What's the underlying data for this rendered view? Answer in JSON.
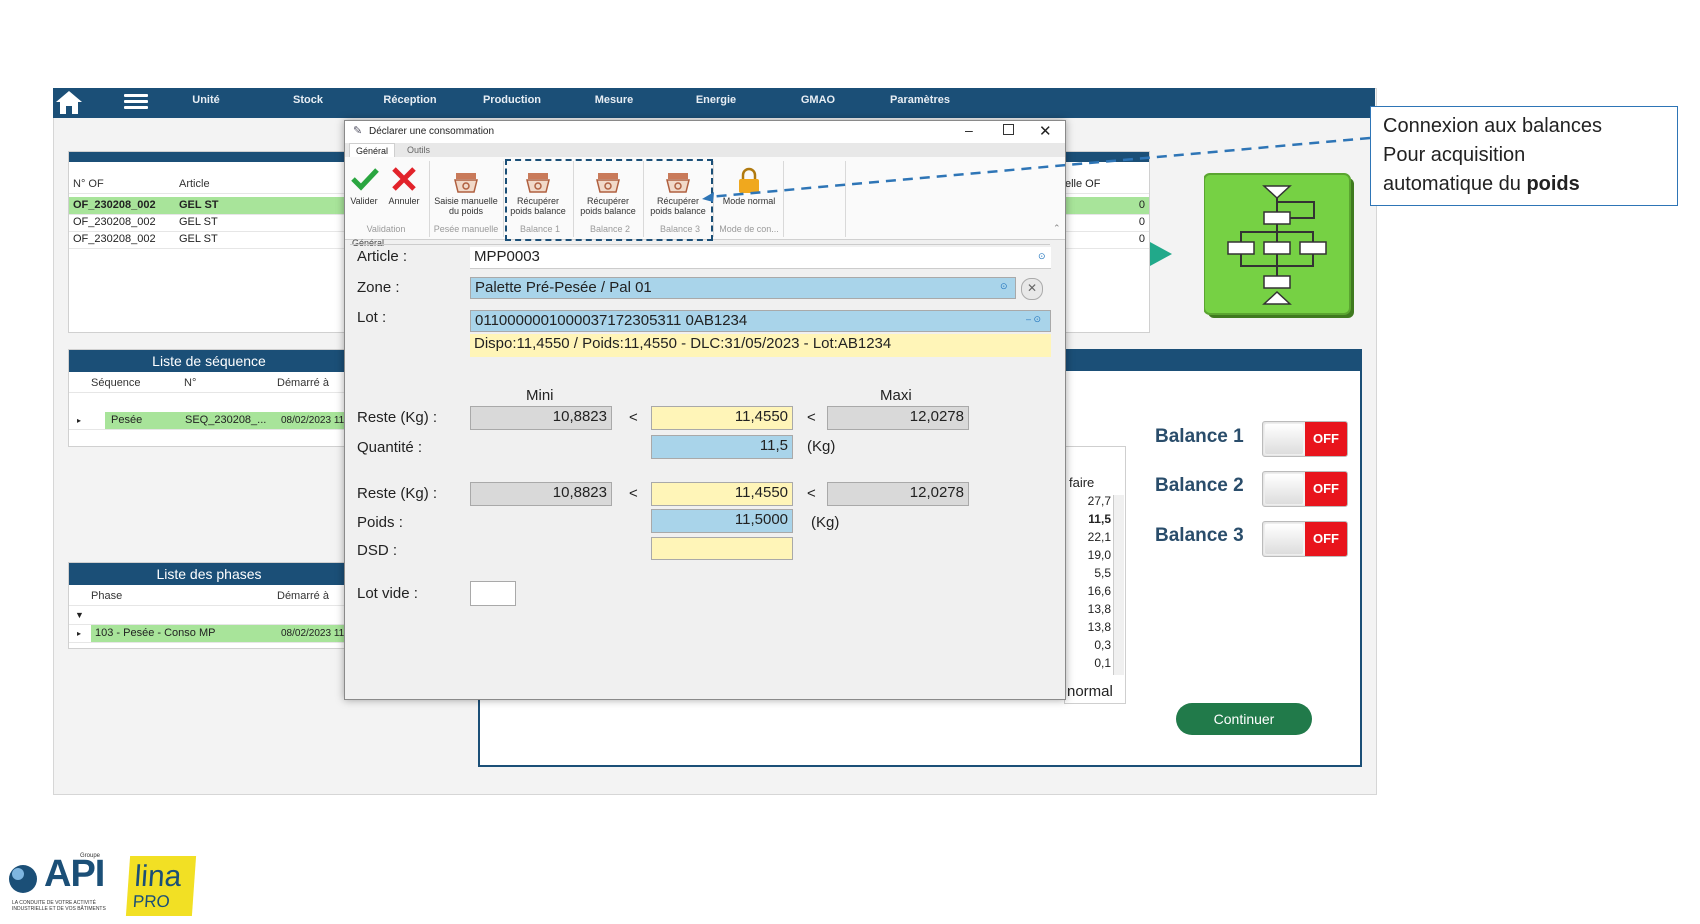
{
  "nav": {
    "items": [
      "Unité",
      "Stock",
      "Réception",
      "Production",
      "Mesure",
      "Energie",
      "GMAO",
      "Paramètres"
    ]
  },
  "of_grid": {
    "headers": [
      "N° OF",
      "Article"
    ],
    "rows": [
      {
        "of": "OF_230208_002",
        "article": "GEL ST"
      },
      {
        "of": "OF_230208_002",
        "article": "GEL ST"
      },
      {
        "of": "OF_230208_002",
        "article": "GEL ST"
      }
    ],
    "right_header": "elle OF",
    "right_values": [
      "0",
      "0",
      "0"
    ]
  },
  "sequence_panel": {
    "title": "Liste de séquence",
    "headers": [
      "Séquence",
      "N°",
      "Démarré à"
    ],
    "row": {
      "sequence": "Pesée",
      "num": "SEQ_230208_...",
      "started": "08/02/2023 11"
    }
  },
  "phases_panel": {
    "title": "Liste des phases",
    "headers": [
      "Phase",
      "Démarré à"
    ],
    "row": {
      "phase": "103 - Pesée - Conso MP",
      "started": "08/02/2023 11"
    }
  },
  "dialog": {
    "title": "Déclarer une consommation",
    "ribbon_tabs": [
      "Général",
      "Outils"
    ],
    "toolbar": {
      "buttons": [
        {
          "label": "Valider"
        },
        {
          "label": "Annuler"
        },
        {
          "label": "Saisie manuelle du poids"
        },
        {
          "label": "Récupérer poids balance"
        },
        {
          "label": "Récupérer poids balance"
        },
        {
          "label": "Récupérer poids balance"
        },
        {
          "label": "Mode normal"
        }
      ],
      "groups": [
        "Validation",
        "Pesée manuelle",
        "Balance 1",
        "Balance 2",
        "Balance 3",
        "Mode de con..."
      ]
    },
    "section_label": "Général",
    "article": {
      "label": "Article :",
      "value": "MPP0003"
    },
    "zone": {
      "label": "Zone :",
      "value": "Palette Pré-Pesée / Pal 01"
    },
    "lot": {
      "label": "Lot :",
      "value": "0110000001000037172305311 0AB1234",
      "info": "Dispo:11,4550 / Poids:11,4550 - DLC:31/05/2023 - Lot:AB1234"
    },
    "mini_label": "Mini",
    "maxi_label": "Maxi",
    "reste1": {
      "label": "Reste (Kg) :",
      "mini": "10,8823",
      "lt1": "<",
      "value": "11,4550",
      "lt2": "<",
      "maxi": "12,0278"
    },
    "quantite": {
      "label": "Quantité :",
      "value": "11,5",
      "unit": "(Kg)"
    },
    "reste2": {
      "label": "Reste (Kg) :",
      "mini": "10,8823",
      "lt1": "<",
      "value": "11,4550",
      "lt2": "<",
      "maxi": "12,0278"
    },
    "poids": {
      "label": "Poids :",
      "value": "11,5000",
      "unit": "(Kg)"
    },
    "dsd": {
      "label": "DSD :"
    },
    "lot_vide": {
      "label": "Lot vide :"
    }
  },
  "right_list": {
    "header": "faire",
    "values": [
      "27,7",
      "11,5",
      "22,1",
      "19,0",
      "5,5",
      "16,6",
      "13,8",
      "13,8",
      "0,3",
      "0,1"
    ],
    "footer": "normal"
  },
  "balances": [
    {
      "label": "Balance 1",
      "state": "OFF"
    },
    {
      "label": "Balance 2",
      "state": "OFF"
    },
    {
      "label": "Balance 3",
      "state": "OFF"
    }
  ],
  "continue_button": "Continuer",
  "callout": {
    "line1": "Connexion aux balances",
    "line2": "Pour acquisition",
    "line3_prefix": "automatique du ",
    "line3_bold": "poids"
  },
  "logos": {
    "api_text": "API",
    "api_group": "Groupe",
    "api_tagline": "LA CONDUITE DE VOTRE ACTIVITÉ INDUSTRIELLE ET DE VOS BÂTIMENTS",
    "lina_text": "lina",
    "lina_pro": "PRO"
  },
  "colors": {
    "nav": "#1b4f77",
    "off": "#e8141c",
    "flow": "#76d144",
    "continue": "#217a4a"
  }
}
